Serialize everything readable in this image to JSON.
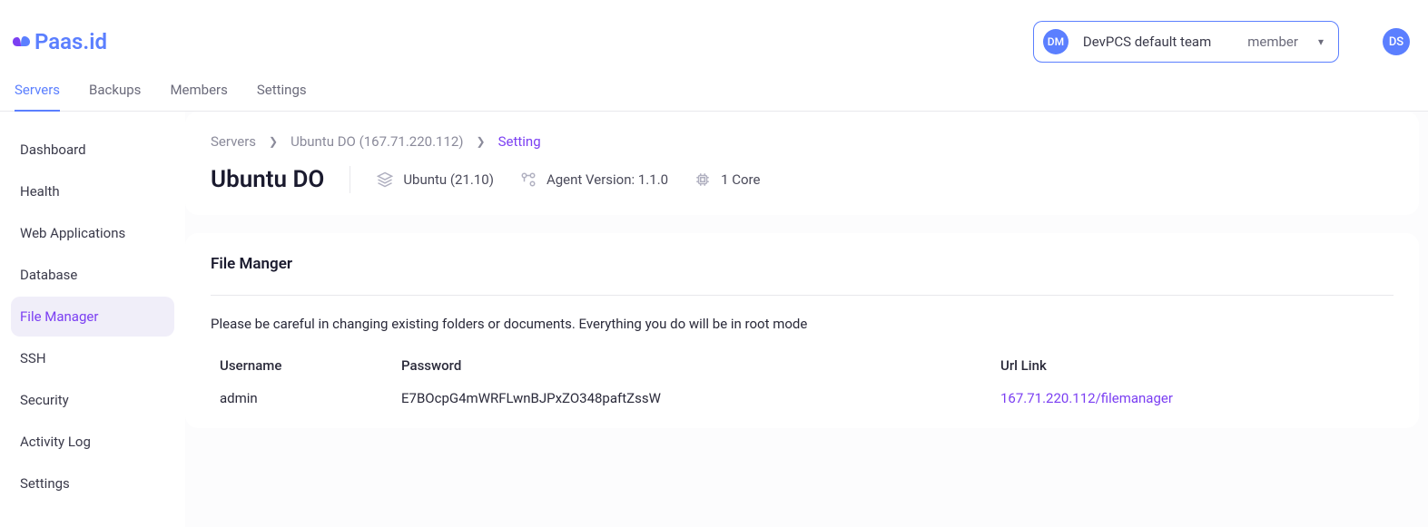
{
  "brand": "Paas.id",
  "header": {
    "team_badge": "DM",
    "team_name": "DevPCS default team",
    "team_role": "member",
    "user_badge": "DS"
  },
  "top_nav": {
    "items": [
      "Servers",
      "Backups",
      "Members",
      "Settings"
    ],
    "active_index": 0
  },
  "sidebar": {
    "items": [
      "Dashboard",
      "Health",
      "Web Applications",
      "Database",
      "File Manager",
      "SSH",
      "Security",
      "Activity Log",
      "Settings"
    ],
    "active_index": 4
  },
  "breadcrumb": {
    "items": [
      "Servers",
      "Ubuntu DO (167.71.220.112)",
      "Setting"
    ]
  },
  "server": {
    "name": "Ubuntu DO",
    "os": "Ubuntu (21.10)",
    "agent_version": "Agent Version: 1.1.0",
    "cores": "1 Core"
  },
  "filemanager": {
    "section_title": "File Manger",
    "warning": "Please be careful in changing existing folders or documents. Everything you do will be in root mode",
    "columns": {
      "username_label": "Username",
      "password_label": "Password",
      "url_label": "Url Link"
    },
    "values": {
      "username": "admin",
      "password": "E7BOcpG4mWRFLwnBJPxZO348paftZssW",
      "url": "167.71.220.112/filemanager"
    }
  }
}
